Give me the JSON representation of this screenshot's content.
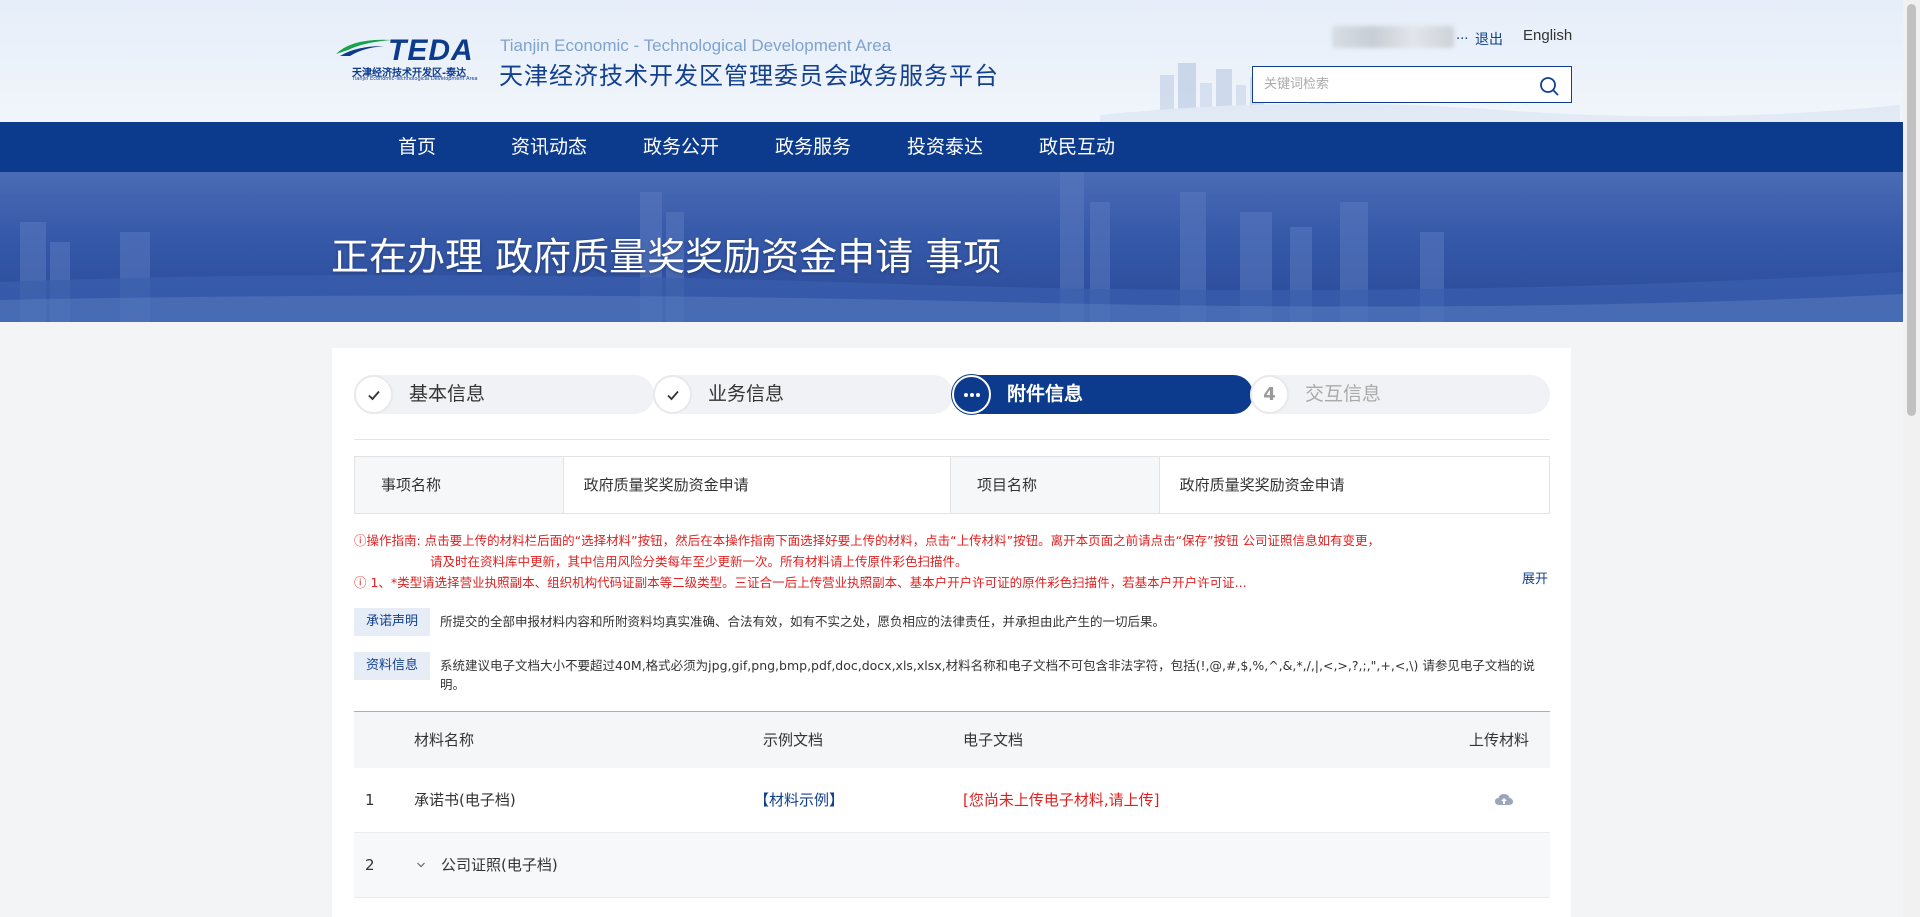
{
  "header": {
    "logo_text": "TEDA",
    "logo_sub_cn": "天津经济技术开发区-泰达",
    "logo_sub_en": "Tianjin Economic-Technological Development Area",
    "site_title_en": "Tianjin Economic - Technological Development Area",
    "site_title_cn": "天津经济技术开发区管理委员会政务服务平台",
    "user_ellipsis": "...",
    "logout_label": "退出",
    "language_label": "English",
    "search_placeholder": "关键词检索"
  },
  "nav": {
    "items": [
      {
        "label": "首页"
      },
      {
        "label": "资讯动态"
      },
      {
        "label": "政务公开"
      },
      {
        "label": "政务服务"
      },
      {
        "label": "投资泰达"
      },
      {
        "label": "政民互动"
      }
    ]
  },
  "banner": {
    "title": "正在办理 政府质量奖奖励资金申请 事项"
  },
  "steps": [
    {
      "label": "基本信息",
      "status": "done"
    },
    {
      "label": "业务信息",
      "status": "done"
    },
    {
      "label": "附件信息",
      "status": "active"
    },
    {
      "label": "交互信息",
      "status": "pending",
      "number": "4"
    }
  ],
  "info": {
    "item_name_label": "事项名称",
    "item_name_value": "政府质量奖奖励资金申请",
    "project_name_label": "项目名称",
    "project_name_value": "政府质量奖奖励资金申请"
  },
  "guide": {
    "line1": "ⓘ操作指南: 点击要上传的材料栏后面的“选择材料”按钮，然后在本操作指南下面选择好要上传的材料，点击“上传材料”按钮。离开本页面之前请点击“保存”按钮 公司证照信息如有变更，",
    "line2": "请及时在资料库中更新，其中信用风险分类每年至少更新一次。所有材料请上传原件彩色扫描件。",
    "line3": "ⓘ 1、*类型请选择营业执照副本、组织机构代码证副本等二级类型。三证合一后上传营业执照副本、基本户开户许可证的原件彩色扫描件，若基本户开户许可证...",
    "expand_label": "展开"
  },
  "commitment": {
    "tag": "承诺声明",
    "text": "所提交的全部申报材料内容和所附资料均真实准确、合法有效，如有不实之处，愿负相应的法律责任，并承担由此产生的一切后果。"
  },
  "material_info": {
    "tag": "资料信息",
    "text": "系统建议电子文档大小不要超过40M,格式必须为jpg,gif,png,bmp,pdf,doc,docx,xls,xlsx,材料名称和电子文档不可包含非法字符，包括(!,@,#,$,%,^,&,*,/,|,<,>,?,;,\",+,<,\\) 请参见电子文档的说明。"
  },
  "materials": {
    "headers": {
      "name": "材料名称",
      "example": "示例文档",
      "electronic": "电子文档",
      "upload": "上传材料"
    },
    "rows": [
      {
        "index": "1",
        "name": "承诺书(电子档)",
        "example": "【材料示例】",
        "status": "[您尚未上传电子材料,请上传]"
      },
      {
        "index": "2",
        "name": "公司证照(电子档)"
      }
    ]
  },
  "colors": {
    "primary": "#0c3a8c",
    "warning": "#e02020",
    "accent_line": "#f0a24b"
  }
}
